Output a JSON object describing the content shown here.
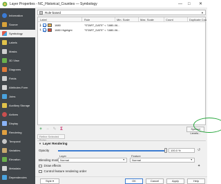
{
  "window": {
    "title": "Layer Properties - NC_Historical_Counties — Symbology",
    "controls": [
      "—",
      "□",
      "✕"
    ]
  },
  "sidebar": {
    "items": [
      {
        "label": "Information",
        "icon": "info-icon",
        "color": "#3a7bd5",
        "active": false
      },
      {
        "label": "Source",
        "icon": "source-icon",
        "color": "#d8a23a",
        "active": false
      },
      {
        "label": "Symbology",
        "icon": "symbology-icon",
        "color": "#e05a4a",
        "active": true
      },
      {
        "label": "Labels",
        "icon": "labels-icon",
        "color": "#e0c24a",
        "active": false
      },
      {
        "label": "Masks",
        "icon": "masks-icon",
        "color": "#cfcfcf",
        "active": false
      },
      {
        "label": "3D View",
        "icon": "3d-view-icon",
        "color": "#6ab04c",
        "active": false
      },
      {
        "label": "Diagrams",
        "icon": "diagrams-icon",
        "color": "#e07b39",
        "active": false
      },
      {
        "label": "Fields",
        "icon": "fields-icon",
        "color": "#cfcfcf",
        "active": false
      },
      {
        "label": "Attributes Form",
        "icon": "attributes-form-icon",
        "color": "#d6d6d6",
        "active": false
      },
      {
        "label": "Joins",
        "icon": "joins-icon",
        "color": "#4aa3df",
        "active": false
      },
      {
        "label": "Auxiliary Storage",
        "icon": "auxiliary-storage-icon",
        "color": "#e0c24a",
        "active": false
      },
      {
        "label": "Actions",
        "icon": "actions-icon",
        "color": "#c94f4f",
        "active": false
      },
      {
        "label": "Display",
        "icon": "display-icon",
        "color": "#8ab4f8",
        "active": false
      },
      {
        "label": "Rendering",
        "icon": "rendering-icon",
        "color": "#e0a040",
        "active": false
      },
      {
        "label": "Temporal",
        "icon": "temporal-icon",
        "color": "#c7c7c7",
        "active": false
      },
      {
        "label": "Variables",
        "icon": "variables-icon",
        "color": "#c9a96e",
        "active": false
      },
      {
        "label": "Elevation",
        "icon": "elevation-icon",
        "color": "#6ab04c",
        "active": false
      },
      {
        "label": "Metadata",
        "icon": "metadata-icon",
        "color": "#d6d6d6",
        "active": false
      },
      {
        "label": "Dependencies",
        "icon": "dependencies-icon",
        "color": "#4aa3df",
        "active": false
      }
    ]
  },
  "renderer": {
    "selected": "Rule-based"
  },
  "rules": {
    "columns": [
      "Label",
      "Rule",
      "Min. Scale",
      "Max. Scale",
      "Count",
      "Duplicate Cou"
    ],
    "rows": [
      {
        "label": "1880",
        "rule": "\"START_DATE\" < '1880-06...",
        "swatch": "#e8b04a"
      },
      {
        "label": "1880 Highlight",
        "rule": "\"START_DATE\" < '1880-06...",
        "swatch": "#d94a3a"
      }
    ]
  },
  "toolbar": {
    "add": "+",
    "remove": "−",
    "edit": "✎",
    "filter": "Σ",
    "symbol_levels": "Symbol Levels..."
  },
  "refine": {
    "label": "Refine Selected Rules"
  },
  "layer_rendering": {
    "header": "Layer Rendering",
    "opacity_label": "Opacity",
    "opacity_value": "100.0 %",
    "opacity_fraction": 1.0,
    "layer_col": "Layer",
    "feature_col": "Feature",
    "blending_label": "Blending mode",
    "layer_blend": "Normal",
    "feature_blend": "Normal",
    "draw_effects": "Draw effects",
    "control_order": "Control feature rendering order"
  },
  "buttons": {
    "style": "Style",
    "ok": "OK",
    "cancel": "Cancel",
    "apply": "Apply",
    "help": "Help"
  }
}
